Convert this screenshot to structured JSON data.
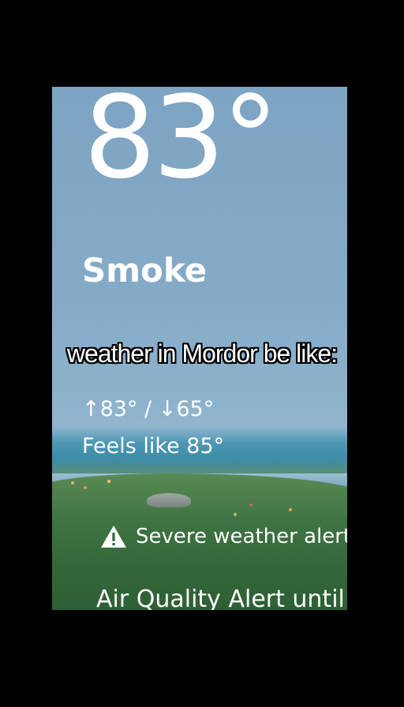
{
  "weather": {
    "temperature": "83°",
    "condition": "Smoke",
    "high_low": "↑83° / ↓65°",
    "feels_like": "Feels like 85°",
    "alert_label": "Severe weather alerts",
    "alert_detail": "Air Quality Alert until"
  },
  "caption": "weather in Mordor be like:",
  "icons": {
    "alert": "warning-triangle-icon"
  },
  "colors": {
    "background": "#000000",
    "sky": "#84a9c6",
    "grass": "#336639",
    "text": "#ffffff"
  }
}
